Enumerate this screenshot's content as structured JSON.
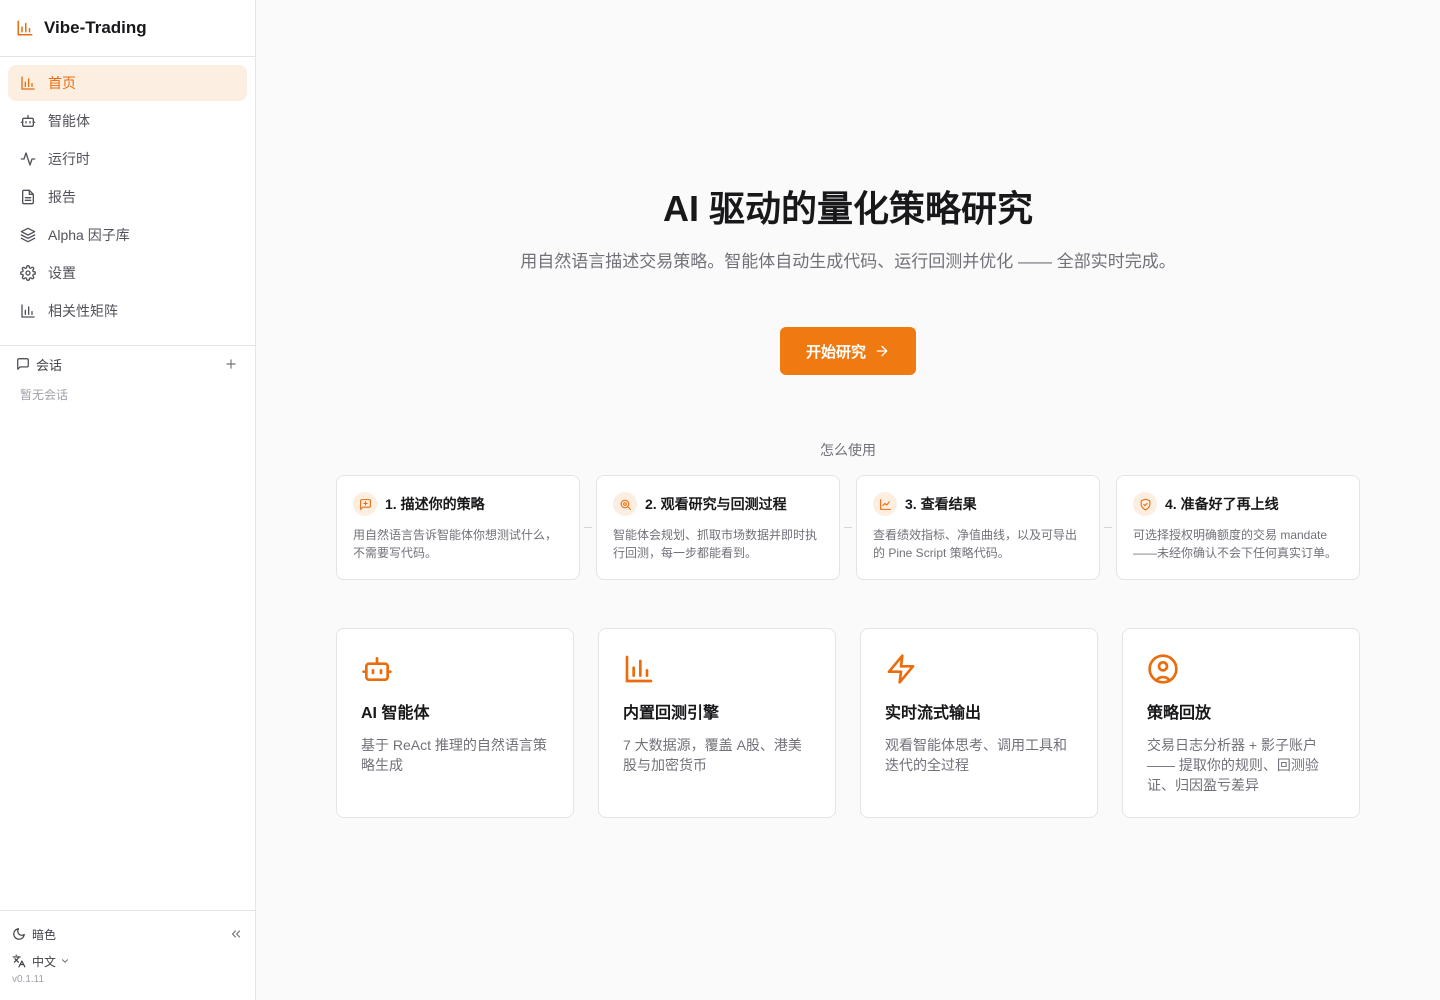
{
  "brand": {
    "name": "Vibe-Trading",
    "accent": "#ea6c0c"
  },
  "nav": [
    {
      "label": "首页",
      "icon": "bar-chart-icon",
      "active": true
    },
    {
      "label": "智能体",
      "icon": "bot-icon"
    },
    {
      "label": "运行时",
      "icon": "activity-icon"
    },
    {
      "label": "报告",
      "icon": "file-text-icon"
    },
    {
      "label": "Alpha 因子库",
      "icon": "layers-icon"
    },
    {
      "label": "设置",
      "icon": "gear-icon"
    },
    {
      "label": "相关性矩阵",
      "icon": "bar-chart-icon"
    }
  ],
  "sessions": {
    "title": "会话",
    "empty": "暂无会话"
  },
  "footer": {
    "theme": "暗色",
    "language": "中文",
    "version": "v0.1.11"
  },
  "hero": {
    "title": "AI 驱动的量化策略研究",
    "subtitle": "用自然语言描述交易策略。智能体自动生成代码、运行回测并优化 —— 全部实时完成。",
    "cta": "开始研究"
  },
  "how": {
    "title": "怎么使用",
    "steps": [
      {
        "title": "1. 描述你的策略",
        "desc": "用自然语言告诉智能体你想测试什么，不需要写代码。"
      },
      {
        "title": "2. 观看研究与回测过程",
        "desc": "智能体会规划、抓取市场数据并即时执行回测，每一步都能看到。"
      },
      {
        "title": "3. 查看结果",
        "desc": "查看绩效指标、净值曲线，以及可导出的 Pine Script 策略代码。"
      },
      {
        "title": "4. 准备好了再上线",
        "desc": "可选择授权明确额度的交易 mandate——未经你确认不会下任何真实订单。"
      }
    ]
  },
  "features": [
    {
      "title": "AI 智能体",
      "desc": "基于 ReAct 推理的自然语言策略生成",
      "icon": "bot-icon"
    },
    {
      "title": "内置回测引擎",
      "desc": "7 大数据源，覆盖 A股、港美股与加密货币",
      "icon": "bar-chart-icon"
    },
    {
      "title": "实时流式输出",
      "desc": "观看智能体思考、调用工具和迭代的全过程",
      "icon": "lightning-icon"
    },
    {
      "title": "策略回放",
      "desc": "交易日志分析器 + 影子账户 —— 提取你的规则、回测验证、归因盈亏差异",
      "icon": "user-circle-icon"
    }
  ]
}
